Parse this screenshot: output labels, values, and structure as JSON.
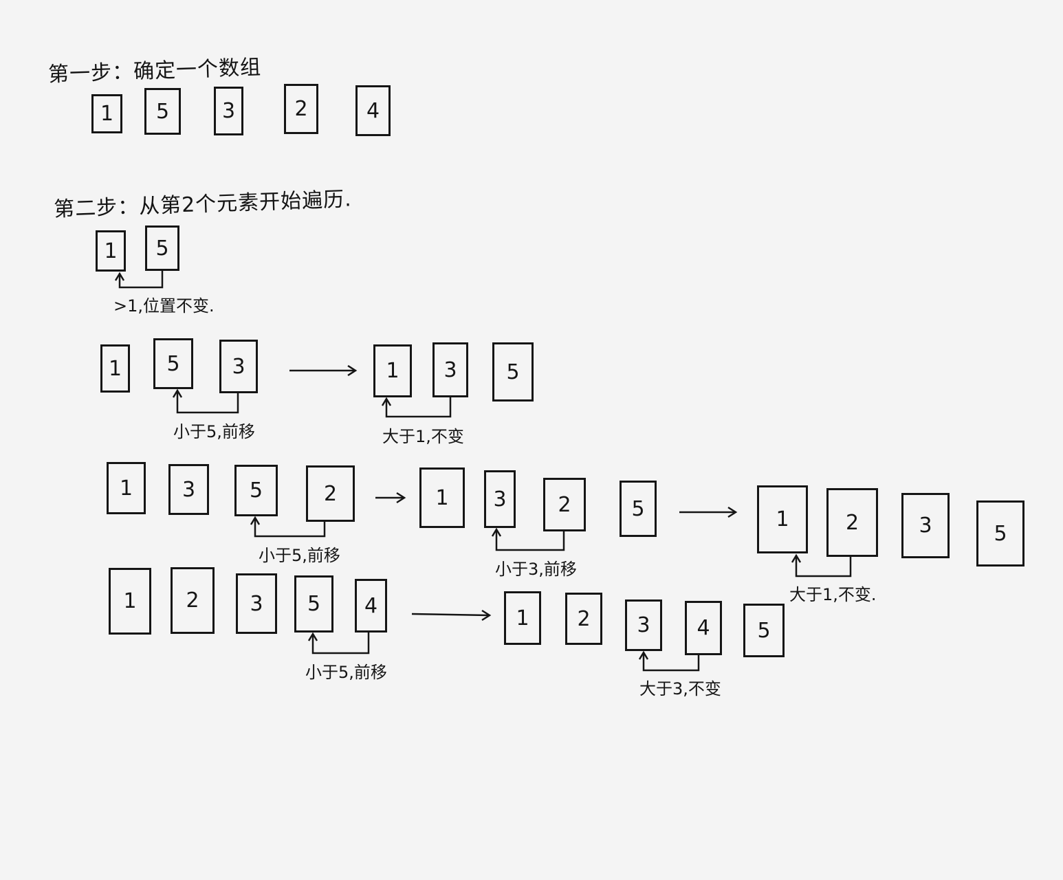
{
  "step1": {
    "title": "第一步：确定一个数组",
    "array": [
      "1",
      "5",
      "3",
      "2",
      "4"
    ]
  },
  "step2": {
    "title": "第二步：从第2个元素开始遍历.",
    "rows": [
      {
        "id": "r1",
        "states": [
          [
            "1",
            "5"
          ]
        ],
        "notes": [
          ">1,位置不变."
        ]
      },
      {
        "id": "r2",
        "states": [
          [
            "1",
            "5",
            "3"
          ],
          [
            "1",
            "3",
            "5"
          ]
        ],
        "notes": [
          "小于5,前移",
          "大于1,不变"
        ]
      },
      {
        "id": "r3",
        "states": [
          [
            "1",
            "3",
            "5",
            "2"
          ],
          [
            "1",
            "3",
            "2",
            "5"
          ],
          [
            "1",
            "2",
            "3",
            "5"
          ]
        ],
        "notes": [
          "小于5,前移",
          "小于3,前移",
          "大于1,不变."
        ]
      },
      {
        "id": "r4",
        "states": [
          [
            "1",
            "2",
            "3",
            "5",
            "4"
          ],
          [
            "1",
            "2",
            "3",
            "4",
            "5"
          ]
        ],
        "notes": [
          "小于5,前移",
          "大于3,不变"
        ]
      }
    ]
  }
}
